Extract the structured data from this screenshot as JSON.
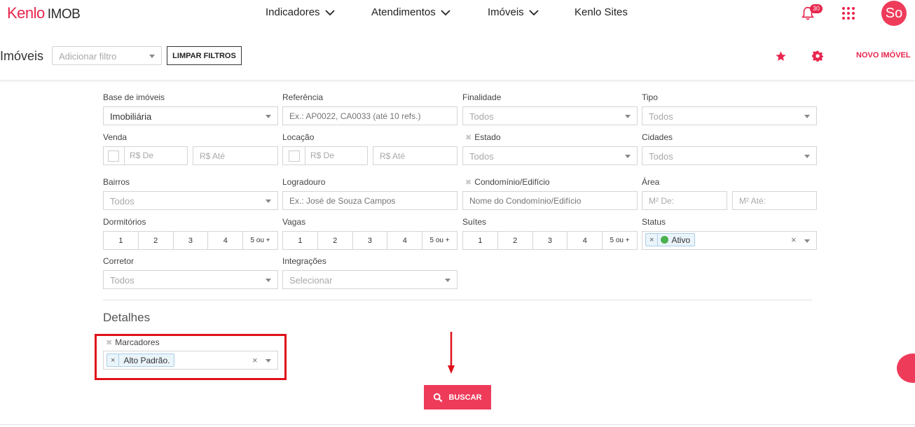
{
  "brand": {
    "name": "Kenlo",
    "product": "IMOB",
    "accent": "#e8254c"
  },
  "nav": {
    "items": [
      {
        "label": "Indicadores",
        "has_menu": true
      },
      {
        "label": "Atendimentos",
        "has_menu": true
      },
      {
        "label": "Imóveis",
        "has_menu": true
      },
      {
        "label": "Kenlo Sites",
        "has_menu": false
      }
    ],
    "notifications_count": "30",
    "avatar_initials": "So"
  },
  "header": {
    "title": "Imóveis",
    "add_filter_placeholder": "Adicionar filtro",
    "clear_filters_label": "LIMPAR FILTROS",
    "new_property_label": "NOVO IMÓVEL"
  },
  "filters": {
    "base": {
      "label": "Base de imóveis",
      "value": "Imobiliária"
    },
    "referencia": {
      "label": "Referência",
      "placeholder": "Ex.: AP0022, CA0033 (até 10 refs.)"
    },
    "finalidade": {
      "label": "Finalidade",
      "value": "Todos"
    },
    "tipo": {
      "label": "Tipo",
      "value": "Todos"
    },
    "venda": {
      "label": "Venda",
      "from_placeholder": "R$ De",
      "to_placeholder": "R$ Até"
    },
    "locacao": {
      "label": "Locação",
      "from_placeholder": "R$ De",
      "to_placeholder": "R$ Até"
    },
    "estado": {
      "label": "Estado",
      "value": "Todos"
    },
    "cidades": {
      "label": "Cidades",
      "value": "Todos"
    },
    "bairros": {
      "label": "Bairros",
      "value": "Todos"
    },
    "logradouro": {
      "label": "Logradouro",
      "placeholder": "Ex.: José de Souza Campos"
    },
    "condominio": {
      "label": "Condomínio/Edifício",
      "placeholder": "Nome do Condomínio/Edifício"
    },
    "area": {
      "label": "Área",
      "from_placeholder": "M² De:",
      "to_placeholder": "M² Até:"
    },
    "dormitorios": {
      "label": "Dormitórios",
      "options": [
        "1",
        "2",
        "3",
        "4",
        "5 ou +"
      ]
    },
    "vagas": {
      "label": "Vagas",
      "options": [
        "1",
        "2",
        "3",
        "4",
        "5 ou +"
      ]
    },
    "suites": {
      "label": "Suítes",
      "options": [
        "1",
        "2",
        "3",
        "4",
        "5 ou +"
      ]
    },
    "status": {
      "label": "Status",
      "tag": "Ativo",
      "tag_color": "#4caf50"
    },
    "corretor": {
      "label": "Corretor",
      "value": "Todos"
    },
    "integracoes": {
      "label": "Integrações",
      "value": "Selecionar"
    }
  },
  "details": {
    "title": "Detalhes",
    "marcadores": {
      "label": "Marcadores",
      "tag": "Alto Padrão."
    }
  },
  "search_label": "BUSCAR",
  "icons": {
    "x": "×",
    "remove": "✖"
  }
}
